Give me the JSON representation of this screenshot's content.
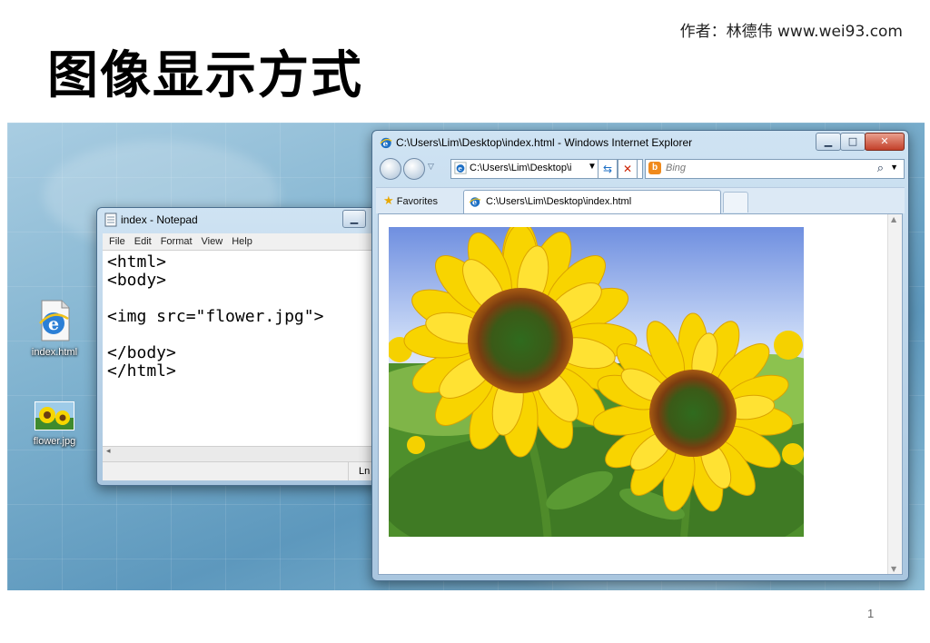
{
  "slide": {
    "title": "图像显示方式",
    "author": "作者：林德伟 www.wei93.com",
    "page_number": "1"
  },
  "desktop": {
    "icons": [
      {
        "label": "index.html",
        "icon": "ie-html-file-icon"
      },
      {
        "label": "flower.jpg",
        "icon": "jpg-thumbnail-icon"
      }
    ]
  },
  "notepad": {
    "title": "index - Notepad",
    "menu": [
      "File",
      "Edit",
      "Format",
      "View",
      "Help"
    ],
    "content": "<html>\n<body>\n\n<img src=\"flower.jpg\">\n\n</body>\n</html>",
    "status": "Ln"
  },
  "ie": {
    "title": "C:\\Users\\Lim\\Desktop\\index.html - Windows Internet Explorer",
    "address": "C:\\Users\\Lim\\Desktop\\i",
    "search_placeholder": "Bing",
    "favorites_label": "Favorites",
    "tab_label": "C:\\Users\\Lim\\Desktop\\index.html"
  },
  "colors": {
    "ie_blue": "#1d6fc4",
    "close_red": "#c3402a",
    "sunflower_yellow": "#f7d600"
  }
}
